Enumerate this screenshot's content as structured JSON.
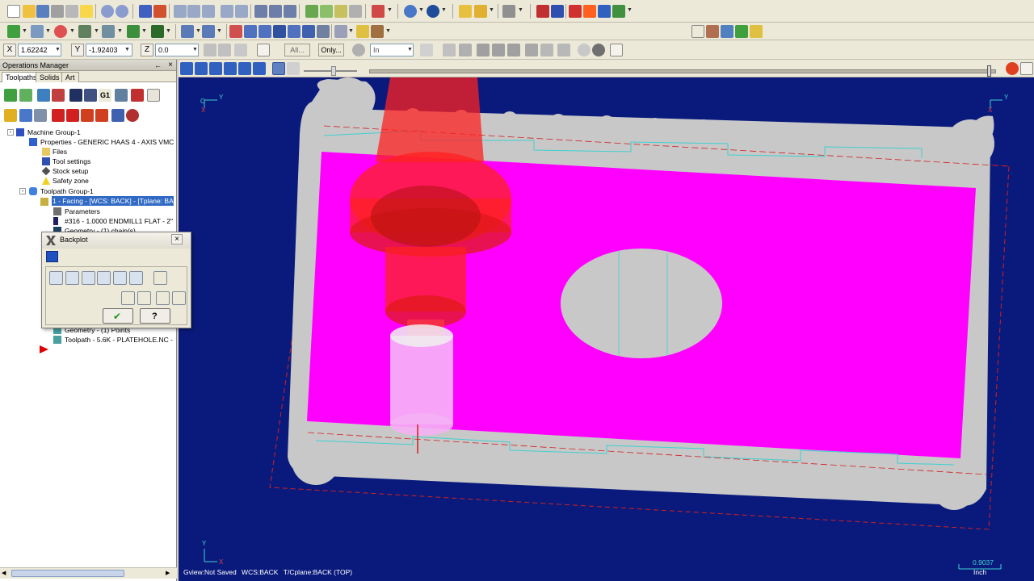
{
  "toolbar": {
    "x_label": "X",
    "x_value": "1.62242",
    "y_label": "Y",
    "y_value": "-1.92403",
    "z_label": "Z",
    "z_value": "0.0",
    "all_button": "All...",
    "only_button": "Only...",
    "units_select": "In"
  },
  "ops_manager": {
    "title": "Operations Manager",
    "pin_glyph": "←",
    "close_glyph": "×",
    "tabs": [
      "Toolpaths",
      "Solids",
      "Art"
    ],
    "tree": [
      "Machine Group-1",
      "Properties - GENERIC HAAS 4 - AXIS VMC",
      "Files",
      "Tool settings",
      "Stock setup",
      "Safety zone",
      "Toolpath Group-1",
      "1 - Facing - [WCS: BACK] - [Tplane: BAC",
      "Parameters",
      "#316 - 1.0000 ENDMILL1 FLAT - 2\" F",
      "Geometry - (1) chain(s)",
      "Geometry - (1) Points",
      "Toolpath - 5.6K - PLATEHOLE.NC - Pr"
    ]
  },
  "backplot": {
    "title": "Backplot",
    "close_glyph": "×",
    "ok_glyph": "✔",
    "help_glyph": "?"
  },
  "playback": {
    "progress_fraction": 0.99
  },
  "status": {
    "gview": "Gview:Not Saved",
    "wcs": "WCS:BACK",
    "tcplane": "T/Cplane:BACK (TOP)",
    "scale_value": "0.9037",
    "scale_unit": "Inch"
  },
  "axis_labels": {
    "y": "Y",
    "x": "X",
    "c": "C"
  },
  "colors": {
    "viewport_bg": "#0a1a7c",
    "stock_magenta": "#ff00ff",
    "part_gray": "#c8c8c8",
    "tool_red": "#ff2020",
    "selection_blue": "#316ac5"
  },
  "icons": {
    "new": "new-file-icon",
    "open": "open-folder-icon",
    "save": "save-icon",
    "print": "print-icon",
    "undo": "undo-icon",
    "redo": "redo-icon",
    "play": "play-icon",
    "stop": "stop-icon",
    "step_back": "step-back-icon",
    "step_forward": "step-forward-icon",
    "rewind": "rewind-icon",
    "fast_forward": "fast-forward-icon",
    "machine_group": "machine-group-icon",
    "file": "files-folder-icon",
    "tool": "tool-settings-icon",
    "stock": "stock-setup-icon",
    "safety": "safety-zone-icon",
    "toolpath_group": "toolpath-group-icon",
    "op": "operation-icon",
    "param": "parameters-icon",
    "toolpath": "toolpath-icon",
    "insert_arrow": "insert-arrow-icon",
    "backplot": "backplot-icon",
    "ok": "ok-check-icon",
    "help": "help-icon",
    "warning": "warning-icon"
  }
}
